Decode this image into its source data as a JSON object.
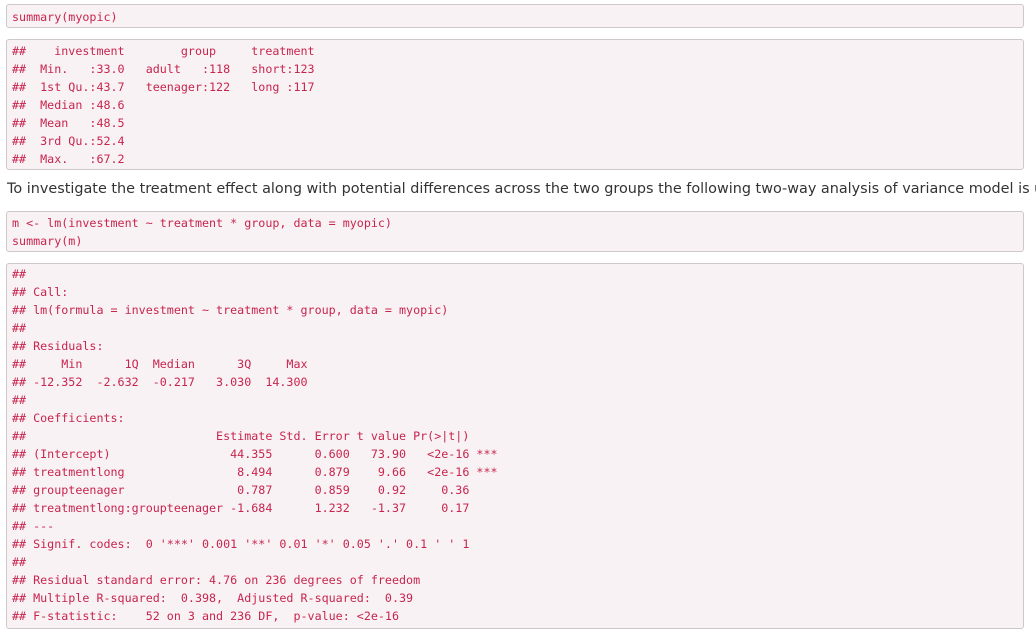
{
  "input1": [
    "summary(myopic)"
  ],
  "output1": [
    "##    investment        group     treatment",
    "##  Min.   :33.0   adult   :118   short:123",
    "##  1st Qu.:43.7   teenager:122   long :117",
    "##  Median :48.6",
    "##  Mean   :48.5",
    "##  3rd Qu.:52.4",
    "##  Max.   :67.2"
  ],
  "paragraph": "To investigate the treatment effect along with potential differences across the two groups the following two-way analysis of variance model is used.",
  "input2": [
    "m <- lm(investment ~ treatment * group, data = myopic)",
    "summary(m)"
  ],
  "output2": [
    "##",
    "## Call:",
    "## lm(formula = investment ~ treatment * group, data = myopic)",
    "##",
    "## Residuals:",
    "##     Min      1Q  Median      3Q     Max",
    "## -12.352  -2.632  -0.217   3.030  14.300",
    "##",
    "## Coefficients:",
    "##                           Estimate Std. Error t value Pr(>|t|)",
    "## (Intercept)                 44.355      0.600   73.90   <2e-16 ***",
    "## treatmentlong                8.494      0.879    9.66   <2e-16 ***",
    "## groupteenager                0.787      0.859    0.92     0.36",
    "## treatmentlong:groupteenager -1.684      1.232   -1.37     0.17",
    "## ---",
    "## Signif. codes:  0 '***' 0.001 '**' 0.01 '*' 0.05 '.' 0.1 ' ' 1",
    "##",
    "## Residual standard error: 4.76 on 236 degrees of freedom",
    "## Multiple R-squared:  0.398,  Adjusted R-squared:  0.39",
    "## F-statistic:    52 on 3 and 236 DF,  p-value: <2e-16"
  ]
}
